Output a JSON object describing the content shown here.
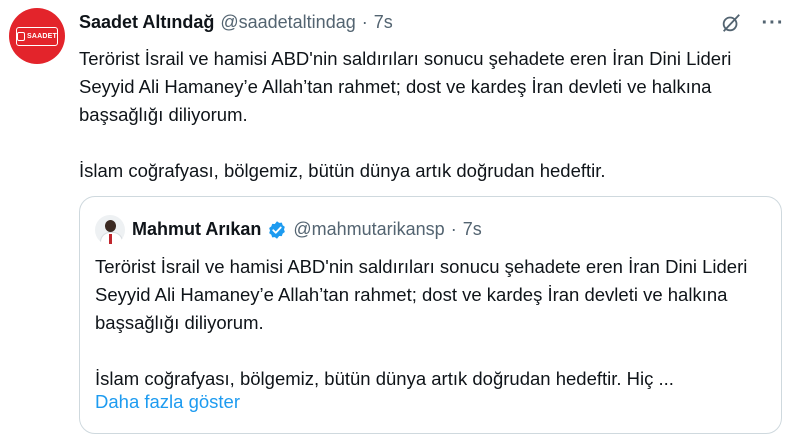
{
  "tweet": {
    "author_name": "Saadet Altındağ",
    "handle": "@saadetaltindag",
    "separator": "·",
    "time": "7s",
    "avatar_logo_text": "SAADET",
    "paragraphs": [
      "Terörist İsrail ve hamisi ABD'nin saldırıları sonucu şehadete eren İran Dini Lideri Seyyid Ali Hamaney’e Allah’tan rahmet; dost ve kardeş İran devleti ve halkına başsağlığı diliyorum.",
      "İslam coğrafyası, bölgemiz, bütün dünya artık doğrudan hedeftir."
    ],
    "more_label": "···"
  },
  "quote": {
    "author_name": "Mahmut Arıkan",
    "handle": "@mahmutarikansp",
    "separator": "·",
    "time": "7s",
    "paragraphs": [
      "Terörist İsrail ve hamisi ABD'nin saldırıları sonucu şehadete eren İran Dini Lideri Seyyid Ali Hamaney’e Allah’tan rahmet; dost ve kardeş İran devleti ve halkına başsağlığı diliyorum.",
      "İslam coğrafyası, bölgemiz, bütün dünya artık doğrudan hedeftir. Hiç ..."
    ],
    "show_more": "Daha fazla göster"
  },
  "colors": {
    "text": "#0f1419",
    "muted": "#536471",
    "link": "#1d9bf0",
    "brand_red": "#e3242b",
    "border": "#cfd9de"
  },
  "icons": [
    "grok-icon",
    "more-icon",
    "verified-badge-icon"
  ]
}
